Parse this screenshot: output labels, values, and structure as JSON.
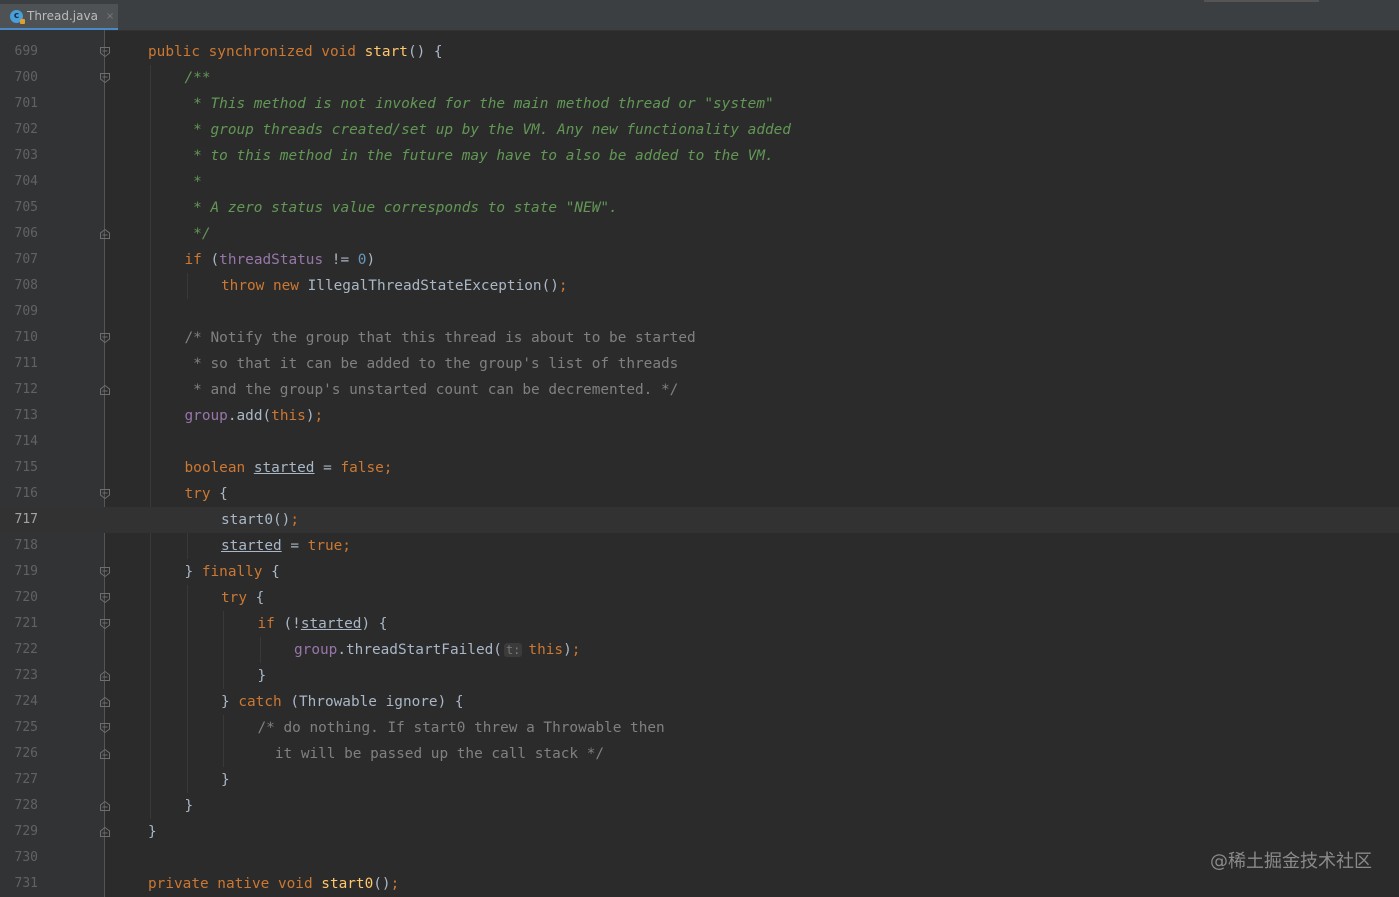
{
  "tab": {
    "filename": "Thread.java",
    "icon": "java-class-icon",
    "close": "×"
  },
  "watermark": "@稀土掘金技术社区",
  "lines": [
    {
      "n": "699",
      "indent": 0,
      "segs": [
        [
          "kw",
          "public synchronized void "
        ],
        [
          "fn",
          "start"
        ],
        [
          "",
          "() {"
        ]
      ]
    },
    {
      "n": "700",
      "indent": 1,
      "segs": [
        [
          "doc",
          "/**"
        ]
      ]
    },
    {
      "n": "701",
      "indent": 1,
      "segs": [
        [
          "doc",
          " * This method is not invoked for the main method thread or \"system\""
        ]
      ]
    },
    {
      "n": "702",
      "indent": 1,
      "segs": [
        [
          "doc",
          " * group threads created/set up by the VM. Any new functionality added"
        ]
      ]
    },
    {
      "n": "703",
      "indent": 1,
      "segs": [
        [
          "doc",
          " * to this method in the future may have to also be added to the VM."
        ]
      ]
    },
    {
      "n": "704",
      "indent": 1,
      "segs": [
        [
          "doc",
          " *"
        ]
      ]
    },
    {
      "n": "705",
      "indent": 1,
      "segs": [
        [
          "doc",
          " * A zero status value corresponds to state \"NEW\"."
        ]
      ]
    },
    {
      "n": "706",
      "indent": 1,
      "segs": [
        [
          "doc",
          " */"
        ]
      ]
    },
    {
      "n": "707",
      "indent": 1,
      "segs": [
        [
          "kw",
          "if "
        ],
        [
          "",
          "("
        ],
        [
          "fld",
          "threadStatus"
        ],
        [
          "",
          " != "
        ],
        [
          "num",
          "0"
        ],
        [
          "",
          ")"
        ]
      ]
    },
    {
      "n": "708",
      "indent": 2,
      "segs": [
        [
          "kw",
          "throw new "
        ],
        [
          "",
          "IllegalThreadStateException()"
        ],
        [
          "kw",
          ";"
        ]
      ]
    },
    {
      "n": "709",
      "indent": 0,
      "segs": []
    },
    {
      "n": "710",
      "indent": 1,
      "segs": [
        [
          "cmt",
          "/* Notify the group that this thread is about to be started"
        ]
      ]
    },
    {
      "n": "711",
      "indent": 1,
      "segs": [
        [
          "cmt",
          " * so that it can be added to the group's list of threads"
        ]
      ]
    },
    {
      "n": "712",
      "indent": 1,
      "segs": [
        [
          "cmt",
          " * and the group's unstarted count can be decremented. */"
        ]
      ]
    },
    {
      "n": "713",
      "indent": 1,
      "segs": [
        [
          "fld",
          "group"
        ],
        [
          "",
          ".add("
        ],
        [
          "kw",
          "this"
        ],
        [
          "",
          ")"
        ],
        [
          "kw",
          ";"
        ]
      ]
    },
    {
      "n": "714",
      "indent": 0,
      "segs": []
    },
    {
      "n": "715",
      "indent": 1,
      "segs": [
        [
          "kw",
          "boolean "
        ],
        [
          "ul",
          "started"
        ],
        [
          "",
          " = "
        ],
        [
          "kw",
          "false;"
        ]
      ]
    },
    {
      "n": "716",
      "indent": 1,
      "segs": [
        [
          "kw",
          "try "
        ],
        [
          "",
          "{"
        ]
      ]
    },
    {
      "n": "717",
      "indent": 2,
      "segs": [
        [
          "",
          "start0()"
        ],
        [
          "kw",
          ";"
        ]
      ]
    },
    {
      "n": "718",
      "indent": 2,
      "segs": [
        [
          "ul",
          "started"
        ],
        [
          "",
          " = "
        ],
        [
          "kw",
          "true;"
        ]
      ]
    },
    {
      "n": "719",
      "indent": 1,
      "segs": [
        [
          "",
          "} "
        ],
        [
          "kw",
          "finally "
        ],
        [
          "",
          "{"
        ]
      ]
    },
    {
      "n": "720",
      "indent": 2,
      "segs": [
        [
          "kw",
          "try "
        ],
        [
          "",
          "{"
        ]
      ]
    },
    {
      "n": "721",
      "indent": 3,
      "segs": [
        [
          "kw",
          "if "
        ],
        [
          "",
          "(!"
        ],
        [
          "ul",
          "started"
        ],
        [
          "",
          ") {"
        ]
      ]
    },
    {
      "n": "722",
      "indent": 4,
      "segs": [
        [
          "fld",
          "group"
        ],
        [
          "",
          ".threadStartFailed("
        ],
        [
          "hint",
          "t:"
        ],
        [
          "kw",
          "this"
        ],
        [
          "",
          ")"
        ],
        [
          "kw",
          ";"
        ]
      ]
    },
    {
      "n": "723",
      "indent": 3,
      "segs": [
        [
          "",
          "}"
        ]
      ]
    },
    {
      "n": "724",
      "indent": 2,
      "segs": [
        [
          "",
          "} "
        ],
        [
          "kw",
          "catch "
        ],
        [
          "",
          "(Throwable ignore) {"
        ]
      ]
    },
    {
      "n": "725",
      "indent": 3,
      "segs": [
        [
          "cmt",
          "/* do nothing. If start0 threw a Throwable then"
        ]
      ]
    },
    {
      "n": "726",
      "indent": 3,
      "segs": [
        [
          "cmt",
          "  it will be passed up the call stack */"
        ]
      ]
    },
    {
      "n": "727",
      "indent": 2,
      "segs": [
        [
          "",
          "}"
        ]
      ]
    },
    {
      "n": "728",
      "indent": 1,
      "segs": [
        [
          "",
          "}"
        ]
      ]
    },
    {
      "n": "729",
      "indent": 0,
      "segs": [
        [
          "",
          "}"
        ]
      ]
    },
    {
      "n": "730",
      "indent": 0,
      "segs": []
    },
    {
      "n": "731",
      "indent": 0,
      "segs": [
        [
          "kw",
          "private native void "
        ],
        [
          "fn",
          "start0"
        ],
        [
          "",
          "()"
        ],
        [
          "kw",
          ";"
        ]
      ]
    }
  ],
  "current_line": "717",
  "colors": {
    "background": "#2b2b2b",
    "keyword": "#cc7832",
    "method": "#ffc66d",
    "field": "#9876aa",
    "number": "#6897bb",
    "javadoc": "#629755",
    "comment": "#808080",
    "text": "#a9b7c6"
  }
}
